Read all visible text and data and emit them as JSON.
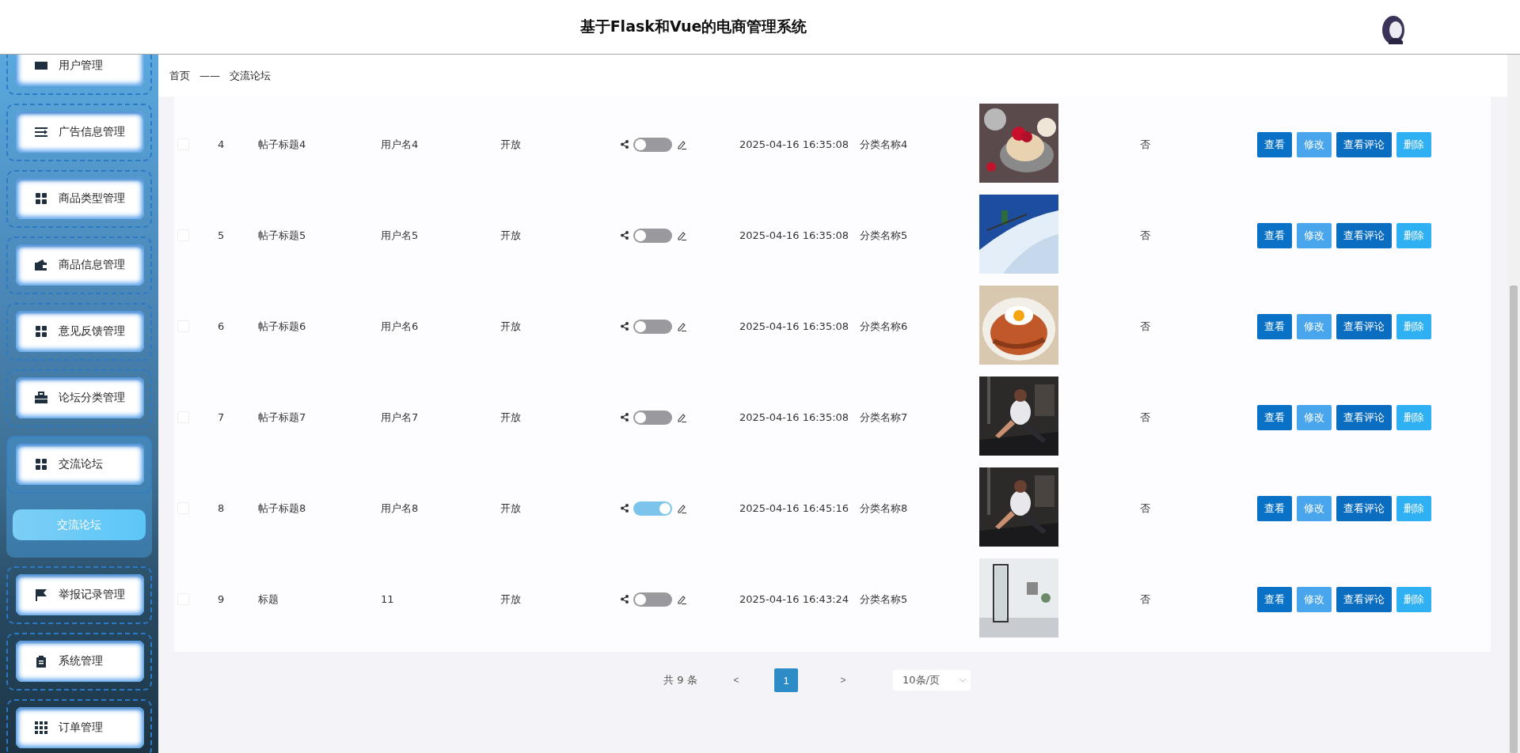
{
  "header": {
    "title": "基于Flask和Vue的电商管理系统"
  },
  "sidebar": {
    "items": [
      {
        "label": "用户管理"
      },
      {
        "label": "广告信息管理"
      },
      {
        "label": "商品类型管理"
      },
      {
        "label": "商品信息管理"
      },
      {
        "label": "意见反馈管理"
      },
      {
        "label": "论坛分类管理"
      },
      {
        "label": "交流论坛",
        "children": [
          {
            "label": "交流论坛",
            "selected": true
          }
        ]
      },
      {
        "label": "举报记录管理"
      },
      {
        "label": "系统管理"
      },
      {
        "label": "订单管理"
      }
    ]
  },
  "breadcrumb": [
    "首页",
    "——",
    "交流论坛"
  ],
  "table": {
    "rows": [
      {
        "checked": false,
        "index": "4",
        "title": "帖子标题4",
        "user": "用户名4",
        "status": "开放",
        "on": false,
        "time": "2025-04-16 16:35:08",
        "category": "分类名称4",
        "flag": "否",
        "actions": [
          {
            "label": "查看",
            "kind": "view"
          },
          {
            "label": "修改",
            "kind": "edit"
          },
          {
            "label": "查看评论",
            "kind": "comments"
          },
          {
            "label": "删除",
            "kind": "delete"
          }
        ]
      },
      {
        "checked": false,
        "index": "5",
        "title": "帖子标题5",
        "user": "用户名5",
        "status": "开放",
        "on": false,
        "time": "2025-04-16 16:35:08",
        "category": "分类名称5",
        "flag": "否",
        "actions": [
          {
            "label": "查看",
            "kind": "view"
          },
          {
            "label": "修改",
            "kind": "edit"
          },
          {
            "label": "查看评论",
            "kind": "comments"
          },
          {
            "label": "删除",
            "kind": "delete"
          }
        ]
      },
      {
        "checked": false,
        "index": "6",
        "title": "帖子标题6",
        "user": "用户名6",
        "status": "开放",
        "on": false,
        "time": "2025-04-16 16:35:08",
        "category": "分类名称6",
        "flag": "否",
        "actions": [
          {
            "label": "查看",
            "kind": "view"
          },
          {
            "label": "修改",
            "kind": "edit"
          },
          {
            "label": "查看评论",
            "kind": "comments"
          },
          {
            "label": "删除",
            "kind": "delete"
          }
        ]
      },
      {
        "checked": false,
        "index": "7",
        "title": "帖子标题7",
        "user": "用户名7",
        "status": "开放",
        "on": false,
        "time": "2025-04-16 16:35:08",
        "category": "分类名称7",
        "flag": "否",
        "actions": [
          {
            "label": "查看",
            "kind": "view"
          },
          {
            "label": "修改",
            "kind": "edit"
          },
          {
            "label": "查看评论",
            "kind": "comments"
          },
          {
            "label": "删除",
            "kind": "delete"
          }
        ]
      },
      {
        "checked": false,
        "index": "8",
        "title": "帖子标题8",
        "user": "用户名8",
        "status": "开放",
        "on": true,
        "time": "2025-04-16 16:45:16",
        "category": "分类名称8",
        "flag": "否",
        "actions": [
          {
            "label": "查看",
            "kind": "view"
          },
          {
            "label": "修改",
            "kind": "edit"
          },
          {
            "label": "查看评论",
            "kind": "comments"
          },
          {
            "label": "删除",
            "kind": "delete"
          }
        ]
      },
      {
        "checked": false,
        "index": "9",
        "title": "标题",
        "user": "11",
        "status": "开放",
        "on": false,
        "time": "2025-04-16 16:43:24",
        "category": "分类名称5",
        "flag": "否",
        "actions": [
          {
            "label": "查看",
            "kind": "view"
          },
          {
            "label": "修改",
            "kind": "edit"
          },
          {
            "label": "查看评论",
            "kind": "comments"
          },
          {
            "label": "删除",
            "kind": "delete"
          }
        ]
      }
    ]
  },
  "pagination": {
    "total": "共 9 条",
    "prev": "<",
    "pages": [
      {
        "label": "1",
        "selected": true
      }
    ],
    "next": ">",
    "page_size": "10条/页"
  }
}
